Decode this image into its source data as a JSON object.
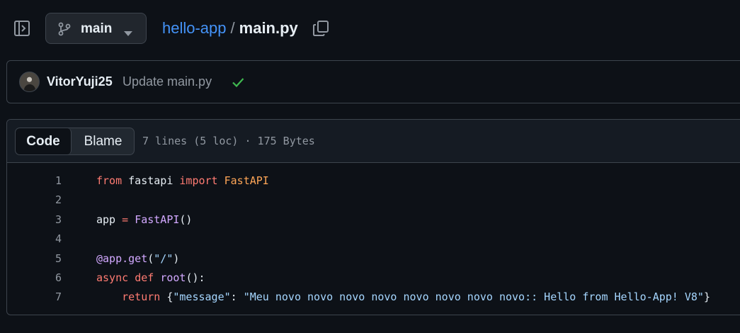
{
  "branch": {
    "label": "main"
  },
  "breadcrumb": {
    "repo": "hello-app",
    "separator": "/",
    "file": "main.py"
  },
  "commit": {
    "author": "VitorYuji25",
    "message": "Update main.py",
    "status": "success"
  },
  "file_view": {
    "tabs": [
      {
        "label": "Code",
        "selected": true
      },
      {
        "label": "Blame",
        "selected": false
      }
    ],
    "meta": "7 lines (5 loc) · 175 Bytes"
  },
  "code": {
    "line_numbers": [
      "1",
      "2",
      "3",
      "4",
      "5",
      "6",
      "7"
    ],
    "lines": [
      [
        {
          "t": "from",
          "c": "kw"
        },
        {
          "t": " fastapi ",
          "c": "plain"
        },
        {
          "t": "import",
          "c": "kw"
        },
        {
          "t": " ",
          "c": "plain"
        },
        {
          "t": "FastAPI",
          "c": "cls"
        }
      ],
      [],
      [
        {
          "t": "app ",
          "c": "plain"
        },
        {
          "t": "=",
          "c": "kw"
        },
        {
          "t": " ",
          "c": "plain"
        },
        {
          "t": "FastAPI",
          "c": "fn"
        },
        {
          "t": "()",
          "c": "plain"
        }
      ],
      [],
      [
        {
          "t": "@app.get",
          "c": "fn"
        },
        {
          "t": "(",
          "c": "plain"
        },
        {
          "t": "\"/\"",
          "c": "str"
        },
        {
          "t": ")",
          "c": "plain"
        }
      ],
      [
        {
          "t": "async",
          "c": "kw"
        },
        {
          "t": " ",
          "c": "plain"
        },
        {
          "t": "def",
          "c": "kw"
        },
        {
          "t": " ",
          "c": "plain"
        },
        {
          "t": "root",
          "c": "fn"
        },
        {
          "t": "():",
          "c": "plain"
        }
      ],
      [
        {
          "t": "    ",
          "c": "plain"
        },
        {
          "t": "return",
          "c": "kw"
        },
        {
          "t": " {",
          "c": "plain"
        },
        {
          "t": "\"message\"",
          "c": "str"
        },
        {
          "t": ": ",
          "c": "plain"
        },
        {
          "t": "\"Meu novo novo novo novo novo novo novo novo:: Hello from Hello-App! V8\"",
          "c": "str"
        },
        {
          "t": "}",
          "c": "plain"
        }
      ]
    ]
  },
  "colors": {
    "background": "#0d1117",
    "link": "#4493f8",
    "success": "#3fb950",
    "keyword": "#ff7b72",
    "function": "#d2a8ff",
    "class": "#ffa657",
    "string": "#a5d6ff"
  },
  "icons": {
    "sidebar_toggle": "sidebar-expand-icon",
    "branch": "git-branch-icon",
    "caret": "triangle-down-icon",
    "copy": "copy-icon",
    "check": "check-icon"
  }
}
